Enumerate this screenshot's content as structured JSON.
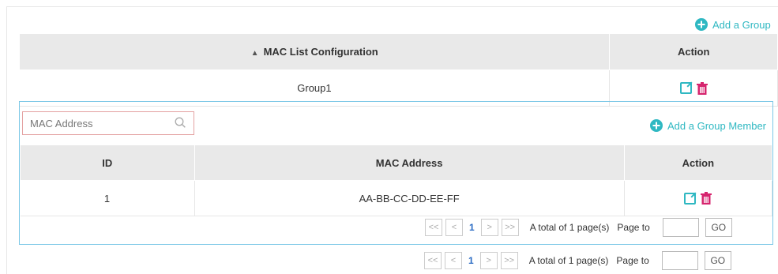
{
  "outer": {
    "add_group_label": "Add a Group",
    "header": {
      "config": "MAC List Configuration",
      "action": "Action"
    },
    "rows": [
      {
        "name": "Group1"
      }
    ],
    "pager": {
      "first": "<<",
      "prev": "<",
      "page": "1",
      "next": ">",
      "last": ">>",
      "total": "A total of 1 page(s)",
      "page_to": "Page to",
      "go": "GO"
    }
  },
  "inner": {
    "search_placeholder": "MAC Address",
    "add_member_label": "Add a Group Member",
    "header": {
      "id": "ID",
      "mac": "MAC Address",
      "action": "Action"
    },
    "rows": [
      {
        "id": "1",
        "mac": "AA-BB-CC-DD-EE-FF"
      }
    ],
    "pager": {
      "first": "<<",
      "prev": "<",
      "page": "1",
      "next": ">",
      "last": ">>",
      "total": "A total of 1 page(s)",
      "page_to": "Page to",
      "go": "GO"
    }
  },
  "colors": {
    "accent": "#2fb8c2",
    "danger": "#d6246e",
    "header_bg": "#e9e9e9",
    "border_active": "#7ac7e6"
  },
  "icons": {
    "add": "plus-circle-icon",
    "edit": "edit-icon",
    "delete": "trash-icon",
    "search": "search-icon",
    "sort": "sort-icon"
  }
}
